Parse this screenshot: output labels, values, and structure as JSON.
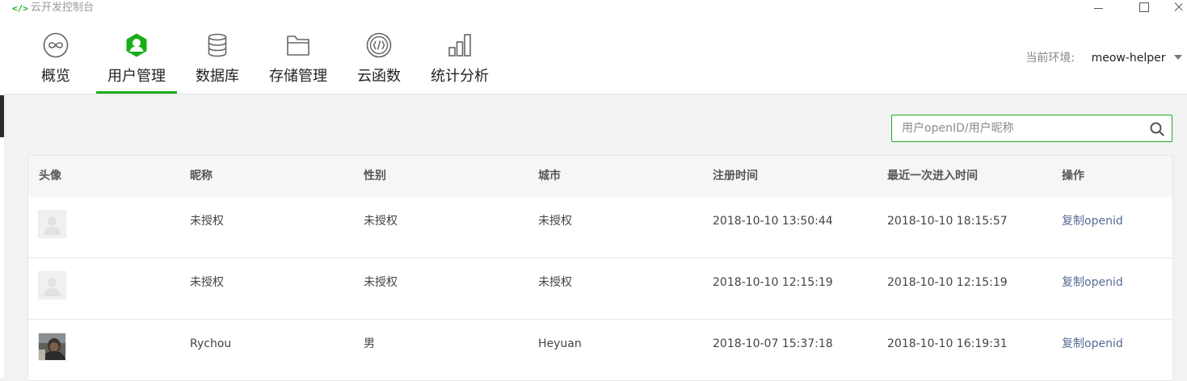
{
  "window": {
    "title": "云开发控制台"
  },
  "nav": {
    "tabs": [
      {
        "label": "概览",
        "icon": "overview-icon"
      },
      {
        "label": "用户管理",
        "icon": "user-icon",
        "active": true
      },
      {
        "label": "数据库",
        "icon": "database-icon"
      },
      {
        "label": "存储管理",
        "icon": "folder-icon"
      },
      {
        "label": "云函数",
        "icon": "function-icon"
      },
      {
        "label": "统计分析",
        "icon": "chart-icon"
      }
    ],
    "env_label": "当前环境:",
    "env_value": "meow-helper"
  },
  "search": {
    "placeholder": "用户openID/用户昵称",
    "value": ""
  },
  "table": {
    "headers": [
      "头像",
      "昵称",
      "性别",
      "城市",
      "注册时间",
      "最近一次进入时间",
      "操作"
    ],
    "rows": [
      {
        "avatar": "default",
        "nickname": "未授权",
        "gender": "未授权",
        "city": "未授权",
        "registered": "2018-10-10 13:50:44",
        "last_entry": "2018-10-10 18:15:57",
        "action": "复制openid"
      },
      {
        "avatar": "default",
        "nickname": "未授权",
        "gender": "未授权",
        "city": "未授权",
        "registered": "2018-10-10 12:15:19",
        "last_entry": "2018-10-10 12:15:19",
        "action": "复制openid"
      },
      {
        "avatar": "photo",
        "nickname": "Rychou",
        "gender": "男",
        "city": "Heyuan",
        "registered": "2018-10-07 15:37:18",
        "last_entry": "2018-10-10 16:19:31",
        "action": "复制openid"
      }
    ]
  },
  "colors": {
    "accent": "#1aad19",
    "link": "#576b95"
  }
}
